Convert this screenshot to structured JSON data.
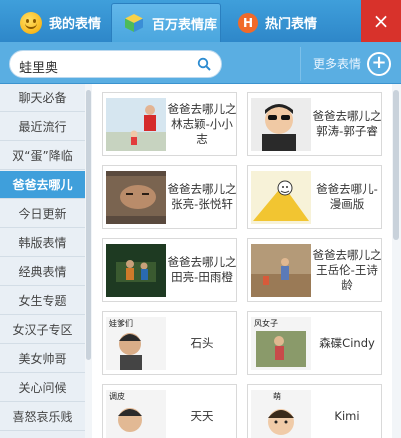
{
  "tabs": {
    "mine": "我的表情",
    "library": "百万表情库",
    "hot": "热门表情",
    "hot_icon_letter": "H"
  },
  "close_label": "×",
  "search": {
    "value": "蛙里奥"
  },
  "more": {
    "label": "更多表情",
    "button": "+"
  },
  "sidebar": {
    "items": [
      "聊天必备",
      "最近流行",
      "双“蛋”降临",
      "爸爸去哪儿",
      "今日更新",
      "韩版表情",
      "经典表情",
      "女生专题",
      "女汉子专区",
      "美女帅哥",
      "关心问候",
      "喜怒哀乐贱"
    ],
    "active_index": 3
  },
  "cards": [
    {
      "label": "爸爸去哪儿之林志颖-小小志"
    },
    {
      "label": "爸爸去哪儿之郭涛-郭子睿"
    },
    {
      "label": "爸爸去哪儿之张亮-张悦轩"
    },
    {
      "label": "爸爸去哪儿-漫画版"
    },
    {
      "label": "爸爸去哪儿之田亮-田雨橙"
    },
    {
      "label": "爸爸去哪儿之王岳伦-王诗龄"
    },
    {
      "label": "石头",
      "thumb_caption": "娃爹们"
    },
    {
      "label": "森碟Cindy",
      "thumb_caption": "风女子"
    },
    {
      "label": "天天",
      "thumb_caption": "调皮"
    },
    {
      "label": "Kimi",
      "thumb_caption": "萌"
    }
  ],
  "colors": {
    "accent": "#3f9fdb",
    "close": "#d8322b"
  }
}
